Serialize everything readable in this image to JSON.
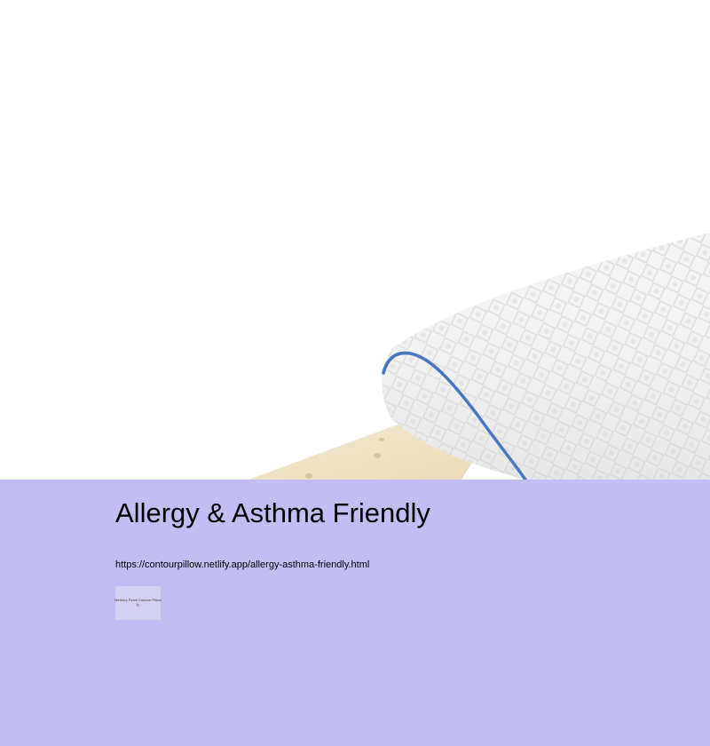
{
  "hero": {
    "image_alt": "Memory foam contour pillow on foam base"
  },
  "page": {
    "title": "Allergy & Asthma Friendly",
    "url": "https://contourpillow.netlify.app/allergy-asthma-friendly.html"
  },
  "thumbnail": {
    "label": "Memory Foam Contour Pillow",
    "icon": "refresh-icon",
    "icon_glyph": "↻"
  },
  "colors": {
    "content_bg": "#c2bdf3",
    "thumb_bg": "#d4d0f2",
    "piping": "#4a77c2"
  }
}
